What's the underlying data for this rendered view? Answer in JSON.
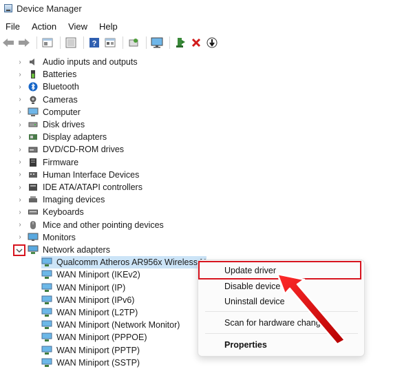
{
  "window": {
    "title": "Device Manager"
  },
  "menu": [
    "File",
    "Action",
    "View",
    "Help"
  ],
  "toolbar": {
    "icons": [
      "back-arrow-icon",
      "forward-arrow-icon",
      "properties-icon",
      "show-hidden-icon",
      "help-icon",
      "view-resources-icon",
      "scan-hardware-icon",
      "monitor-icon",
      "add-driver-icon",
      "uninstall-icon",
      "update-driver-icon"
    ]
  },
  "tree": {
    "categories": [
      {
        "label": "Audio inputs and outputs",
        "icon": "speaker-icon"
      },
      {
        "label": "Batteries",
        "icon": "battery-icon"
      },
      {
        "label": "Bluetooth",
        "icon": "bluetooth-icon"
      },
      {
        "label": "Cameras",
        "icon": "camera-icon"
      },
      {
        "label": "Computer",
        "icon": "computer-icon"
      },
      {
        "label": "Disk drives",
        "icon": "disk-drive-icon"
      },
      {
        "label": "Display adapters",
        "icon": "display-adapter-icon"
      },
      {
        "label": "DVD/CD-ROM drives",
        "icon": "dvd-drive-icon"
      },
      {
        "label": "Firmware",
        "icon": "firmware-icon"
      },
      {
        "label": "Human Interface Devices",
        "icon": "hid-icon"
      },
      {
        "label": "IDE ATA/ATAPI controllers",
        "icon": "ide-controller-icon"
      },
      {
        "label": "Imaging devices",
        "icon": "imaging-device-icon"
      },
      {
        "label": "Keyboards",
        "icon": "keyboard-icon"
      },
      {
        "label": "Mice and other pointing devices",
        "icon": "mouse-icon"
      },
      {
        "label": "Monitors",
        "icon": "monitor-icon"
      },
      {
        "label": "Network adapters",
        "icon": "network-adapter-icon"
      }
    ],
    "network_children": [
      "Qualcomm Atheros AR956x Wireless Ne",
      "WAN Miniport (IKEv2)",
      "WAN Miniport (IP)",
      "WAN Miniport (IPv6)",
      "WAN Miniport (L2TP)",
      "WAN Miniport (Network Monitor)",
      "WAN Miniport (PPPOE)",
      "WAN Miniport (PPTP)",
      "WAN Miniport (SSTP)"
    ]
  },
  "context_menu": {
    "items": [
      "Update driver",
      "Disable device",
      "Uninstall device",
      "Scan for hardware changes",
      "Properties"
    ]
  },
  "colors": {
    "annotation_red": "#d7131e",
    "selection": "#cce4f7"
  }
}
